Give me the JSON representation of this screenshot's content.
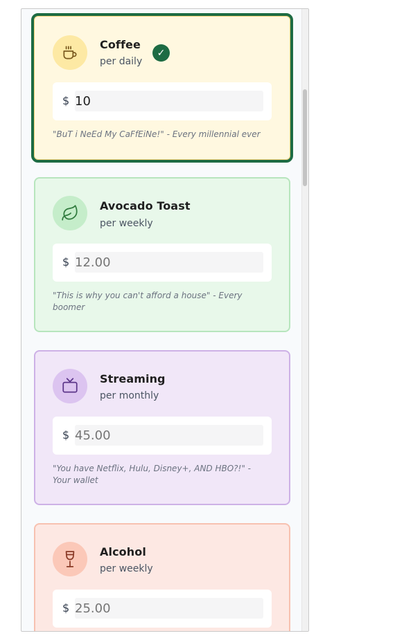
{
  "expenses": [
    {
      "title": "Coffee",
      "frequency": "per daily",
      "currency": "$",
      "amount": "10",
      "quote": "\"BuT i NeEd My CaFfEiNe!\" - Every millennial ever",
      "icon": "coffee-cup-icon",
      "selected": true,
      "colors": {
        "bg": "#fff8e0",
        "border": "#1d6b43",
        "inner_border": "#f5d27a",
        "icon_bg": "#fde9a4",
        "icon": "#7a5a1f"
      }
    },
    {
      "title": "Avocado Toast",
      "frequency": "per weekly",
      "currency": "$",
      "placeholder": "12.00",
      "quote": "\"This is why you can't afford a house\" - Every boomer",
      "icon": "leaf-icon",
      "colors": {
        "bg": "#e8f8ea",
        "border": "#b7e5bd",
        "icon_bg": "#c5edca",
        "icon": "#2f7a3d"
      }
    },
    {
      "title": "Streaming",
      "frequency": "per monthly",
      "currency": "$",
      "placeholder": "45.00",
      "quote": "\"You have Netflix, Hulu, Disney+, AND HBO?!\" - Your wallet",
      "icon": "tv-icon",
      "colors": {
        "bg": "#f1e7f8",
        "border": "#cdb1e6",
        "icon_bg": "#dcc4f0",
        "icon": "#5b3489"
      }
    },
    {
      "title": "Alcohol",
      "frequency": "per weekly",
      "currency": "$",
      "placeholder": "25.00",
      "icon": "wine-glass-icon",
      "colors": {
        "bg": "#fde8e3",
        "border": "#f7c1b0",
        "icon_bg": "#fbc8b8",
        "icon": "#8a3a26"
      }
    }
  ],
  "check_mark": "✓"
}
